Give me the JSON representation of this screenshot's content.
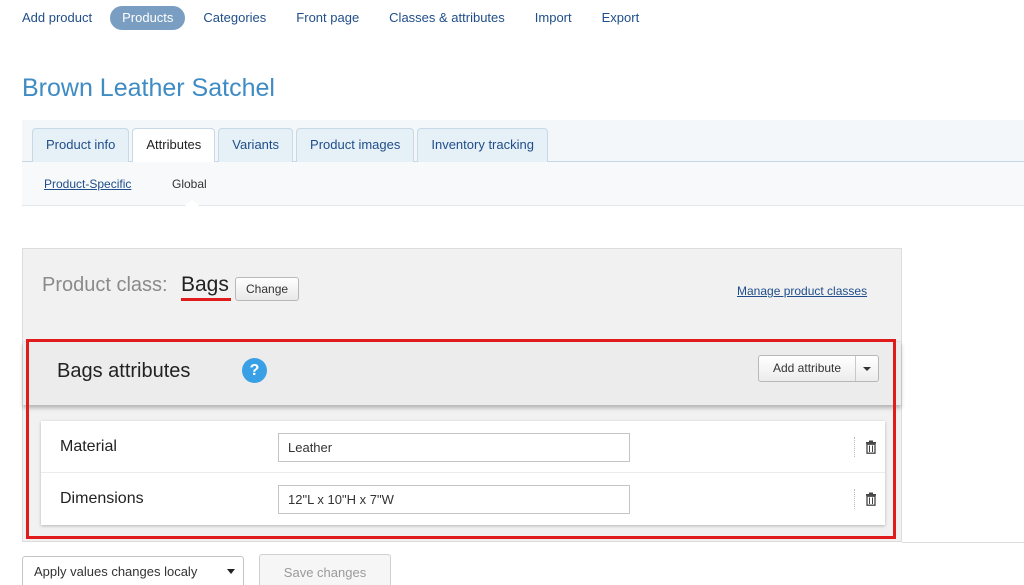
{
  "nav": {
    "items": [
      "Add product",
      "Products",
      "Categories",
      "Front page",
      "Classes & attributes",
      "Import",
      "Export"
    ],
    "active_index": 1
  },
  "page_title": "Brown Leather Satchel",
  "tabs": [
    "Product info",
    "Attributes",
    "Variants",
    "Product images",
    "Inventory tracking"
  ],
  "active_tab_index": 1,
  "subtabs": {
    "product_specific": "Product-Specific",
    "global": "Global"
  },
  "product_class": {
    "label": "Product class:",
    "value": "Bags",
    "change_label": "Change",
    "manage_link": "Manage product classes"
  },
  "attributes_panel": {
    "title": "Bags attributes",
    "help_icon": "question-circle-icon",
    "help_glyph": "?",
    "add_attribute_label": "Add attribute",
    "rows": [
      {
        "name": "Material",
        "value": "Leather"
      },
      {
        "name": "Dimensions",
        "value": "12\"L x 10\"H x 7\"W"
      }
    ],
    "delete_icon": "trash-icon"
  },
  "footer": {
    "apply_select_value": "Apply values changes localy",
    "save_label": "Save changes"
  },
  "colors": {
    "title": "#3f8cc4",
    "link": "#1f4e8a",
    "active_nav": "#7a9ec2",
    "highlight": "#e01b1b",
    "help": "#3aa0e6"
  }
}
